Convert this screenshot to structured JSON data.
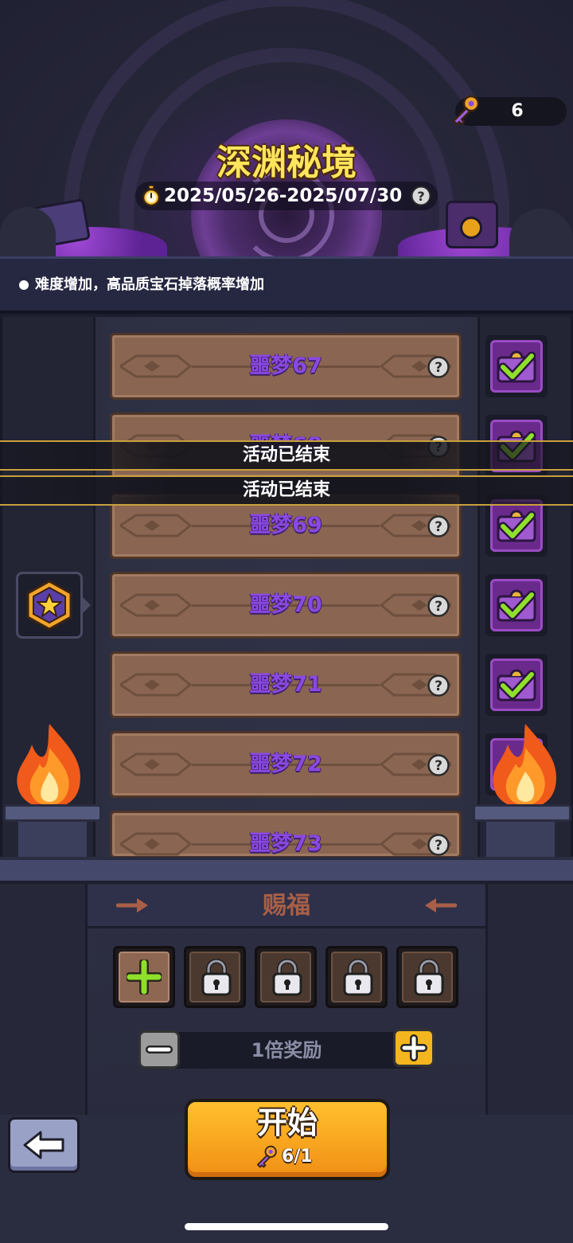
{
  "header": {
    "key_count": "6",
    "title": "深渊秘境",
    "date_range": "2025/05/26-2025/07/30"
  },
  "info": {
    "text": "难度增加，高品质宝石掉落概率增加"
  },
  "levels": [
    {
      "label": "噩梦67",
      "reward_claimed": true
    },
    {
      "label": "噩梦68",
      "reward_claimed": true
    },
    {
      "label": "噩梦69",
      "reward_claimed": true
    },
    {
      "label": "噩梦70",
      "reward_claimed": true,
      "current": true
    },
    {
      "label": "噩梦71",
      "reward_claimed": true
    },
    {
      "label": "噩梦72",
      "reward_claimed": true
    },
    {
      "label": "噩梦73",
      "reward_claimed": false
    }
  ],
  "banners": [
    "活动已结束",
    "活动已结束"
  ],
  "blessing": {
    "title": "赐福",
    "slots": [
      "add",
      "locked",
      "locked",
      "locked",
      "locked"
    ]
  },
  "multiplier": {
    "text": "1倍奖励"
  },
  "start": {
    "label": "开始",
    "cost": "6/1"
  },
  "colors": {
    "title_yellow": "#ffe55c",
    "level_purple": "#8a49e0",
    "start_orange": "#f8a51f",
    "check_green": "#7ed321",
    "blessing_text": "#a85f47"
  }
}
